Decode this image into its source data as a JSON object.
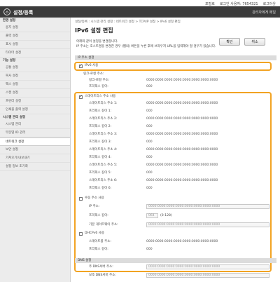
{
  "topbar": {
    "links": [
      "포털로",
      "로그인 사용자: 7654321",
      "로그아웃"
    ]
  },
  "header": {
    "title": "설정/등록",
    "mail_link": "관리자에게 메일"
  },
  "sidebar": {
    "sections": [
      {
        "title": "환경 설정",
        "items": [
          "용지 설정",
          "출력 설정",
          "표시 설정",
          "타이머 설정"
        ]
      },
      {
        "title": "기능 설정",
        "items": [
          "공통 설정",
          "복사 설정",
          "팩스 설정",
          "스캔 설정",
          "프린터 설정",
          "인쇄물 출력 설정"
        ]
      },
      {
        "title": "시스템 관리 설정",
        "items": [
          "시스템 관리",
          "부문별 ID 관리",
          "네트워크 설정",
          "보안 설정",
          "가져오기/내보내기",
          "설정 정보 초기화"
        ]
      }
    ],
    "active_item": "네트워크 설정"
  },
  "main": {
    "breadcrumb": "설정/등록 : 시스템 관리 설정 : 네트워크 설정 > TCP/IP 설정 > IPv6 설정 편집",
    "title": "IPv6 설정 편집",
    "ok_label": "확인",
    "cancel_label": "취소",
    "description": [
      "아래와 같이 설정을 변경합니다.",
      "IP 주소는 호스트명을 변경한 경우 (웹의) 버튼을 누른 후에 브라우저 URL을 입력해야 할 경우가 있습니다."
    ],
    "ip_section_title": "IP 주소 설정",
    "use_ipv6_label": "IPv6 사용",
    "link_local": {
      "title": "링크-로컬 주소:",
      "address_label": "링크-로컬 주소:",
      "address_value": "0000:0000:0000:0000:0000:0000:0000:0000",
      "prefix_label": "프리픽스 길이:",
      "prefix_value": "000"
    },
    "stateless": {
      "label": "스테이트리스 주소 사용",
      "rows": [
        {
          "label": "스테이트리스 주소 1:",
          "value": "0000:0000:0000:0000:0000:0000:0000:0000"
        },
        {
          "label": "프리픽스 길이 1:",
          "value": "000"
        },
        {
          "label": "스테이트리스 주소 2:",
          "value": "0000:0000:0000:0000:0000:0000:0000:0000"
        },
        {
          "label": "프리픽스 길이 2:",
          "value": "000"
        },
        {
          "label": "스테이트리스 주소 3:",
          "value": "0000:0000:0000:0000:0000:0000:0000:0000"
        },
        {
          "label": "프리픽스 길이 3:",
          "value": "000"
        },
        {
          "label": "스테이트리스 주소 4:",
          "value": "0000:0000:0000:0000:0000:0000:0000:0000"
        },
        {
          "label": "프리픽스 길이 4:",
          "value": "000"
        },
        {
          "label": "스테이트리스 주소 5:",
          "value": "0000:0000:0000:0000:0000:0000:0000:0000"
        },
        {
          "label": "프리픽스 길이 5:",
          "value": "000"
        },
        {
          "label": "스테이트리스 주소 6:",
          "value": "0000:0000:0000:0000:0000:0000:0000:0000"
        },
        {
          "label": "프리픽스 길이 6:",
          "value": "000"
        }
      ]
    },
    "manual": {
      "label": "수동 주소 사용",
      "ip_label": "IP 주소:",
      "ip_value": "0000:0000:0000:0000:0000:0000:0000:0000",
      "prefix_label": "프리픽스 길이:",
      "prefix_value": "064",
      "prefix_range": "(0-128)",
      "gateway_label": "기본 게이트웨이 주소:",
      "gateway_value": "0000:0000:0000:0000:0000:0000:0000:0000"
    },
    "dhcp": {
      "label": "DHCPv6 사용",
      "address_label": "스테이트풀 주소:",
      "address_value": "0000:0000:0000:0000:0000:0000:0000:0000",
      "prefix_label": "프리픽스 길이:",
      "prefix_value": "000"
    },
    "dns_section_title": "DNS 설정",
    "dns": {
      "primary_label": "주 DNS서버 주소:",
      "primary_value": "0000:0000:0000:0000:0000:0000:0000:0000",
      "secondary_label": "보조 DNS서버 주소:",
      "secondary_value": "0000:0000:0000:0000:0000:0000:0000:0000"
    }
  },
  "colors": {
    "highlight": "#f2a322",
    "header_bg": "#3b3b3b",
    "sidebar_bg": "#ececec"
  }
}
